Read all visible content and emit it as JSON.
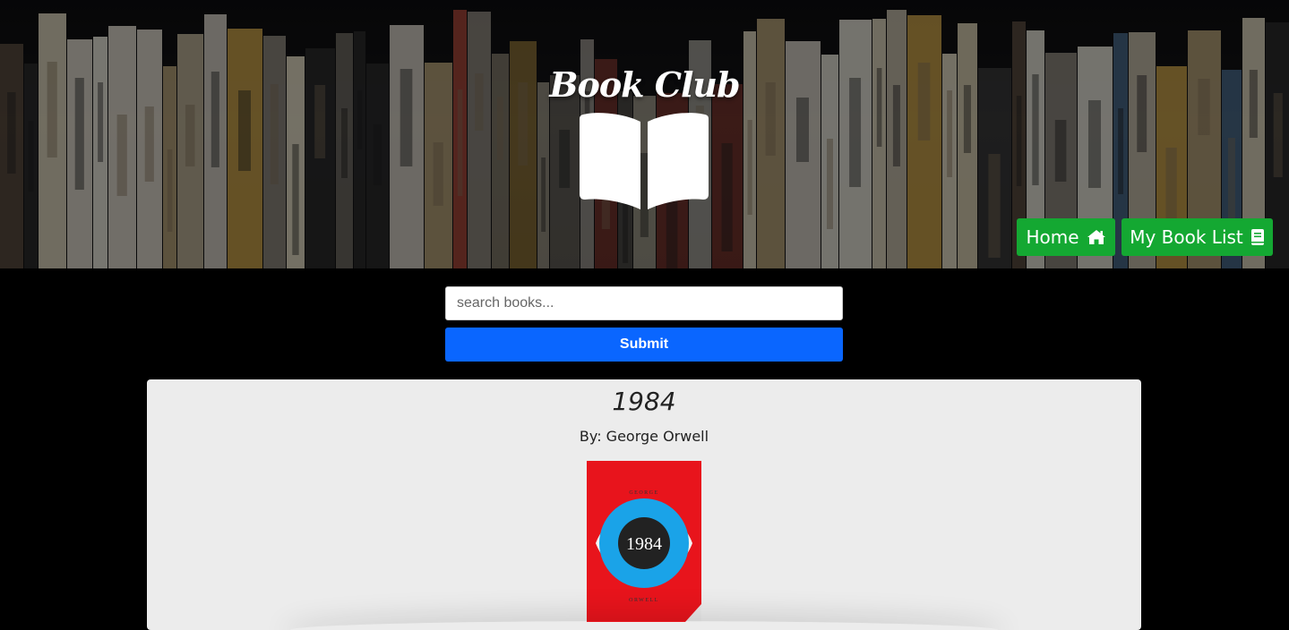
{
  "header": {
    "title": "Book Club",
    "logo_icon": "open-book-icon",
    "nav": [
      {
        "label": "Home",
        "icon": "home-icon"
      },
      {
        "label": "My Book List",
        "icon": "book-icon"
      }
    ],
    "nav_color": "#14a832"
  },
  "search": {
    "placeholder": "search books...",
    "value": "",
    "submit_label": "Submit",
    "submit_color": "#0a66ff"
  },
  "result": {
    "title": "1984",
    "author": "By: George Orwell",
    "cover": {
      "author_top": "GEORGE",
      "title": "1984",
      "author_bottom": "ORWELL",
      "colors": {
        "background": "#e8141c",
        "ring": "#1aa3e8",
        "center": "#222222"
      }
    }
  }
}
